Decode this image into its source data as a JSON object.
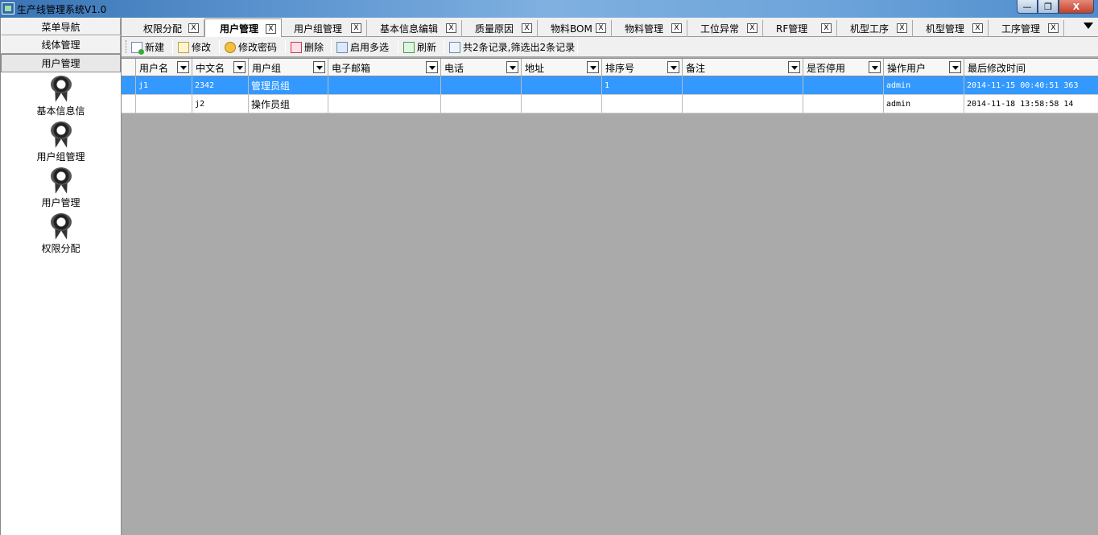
{
  "window": {
    "title": "生产线管理系统V1.0",
    "controls": {
      "minimize": "—",
      "maximize": "❐",
      "close": "X"
    }
  },
  "sidebar": {
    "sections": [
      "菜单导航",
      "线体管理",
      "用户管理"
    ],
    "active_section": "用户管理",
    "items": [
      {
        "label": "基本信息信",
        "icon": "award-medal-icon"
      },
      {
        "label": "用户组管理",
        "icon": "award-medal-icon"
      },
      {
        "label": "用户管理",
        "icon": "award-medal-icon"
      },
      {
        "label": "权限分配",
        "icon": "award-medal-icon"
      }
    ]
  },
  "tabs": [
    {
      "label": "权限分配",
      "close": "X"
    },
    {
      "label": "用户管理",
      "close": "X",
      "active": true
    },
    {
      "label": "用户组管理",
      "close": "X"
    },
    {
      "label": "基本信息编辑",
      "close": "X"
    },
    {
      "label": "质量原因",
      "close": "X"
    },
    {
      "label": "物料BOM",
      "close": "X"
    },
    {
      "label": "物料管理",
      "close": "X"
    },
    {
      "label": "工位异常",
      "close": "X"
    },
    {
      "label": "RF管理",
      "close": "X"
    },
    {
      "label": "机型工序",
      "close": "X"
    },
    {
      "label": "机型管理",
      "close": "X"
    },
    {
      "label": "工序管理",
      "close": "X"
    }
  ],
  "toolbar": {
    "new_label": "新建",
    "edit_label": "修改",
    "change_password_label": "修改密码",
    "delete_label": "删除",
    "multi_select_label": "启用多选",
    "refresh_label": "刷新",
    "record_count_label": "共2条记录,筛选出2条记录"
  },
  "table": {
    "columns": [
      "用户名",
      "中文名",
      "用户组",
      "电子邮箱",
      "电话",
      "地址",
      "排序号",
      "备注",
      "是否停用",
      "操作用户",
      "最后修改时间"
    ],
    "rows": [
      {
        "username": "j1",
        "chinese_name": "2342",
        "group": "管理员组",
        "email": "",
        "phone": "",
        "address": "",
        "sort": "1",
        "remark": "",
        "disabled": "",
        "operator": "admin",
        "modified": "2014-11-15 00:40:51 363",
        "selected": true
      },
      {
        "username": "",
        "chinese_name": "j2",
        "group": "操作员组",
        "email": "",
        "phone": "",
        "address": "",
        "sort": "",
        "remark": "",
        "disabled": "",
        "operator": "admin",
        "modified": "2014-11-18 13:58:58 14",
        "selected": false
      }
    ]
  },
  "colors": {
    "selection": "#3399ff",
    "workspace": "#aaaaaa",
    "titlebar": "#5b93cf"
  }
}
